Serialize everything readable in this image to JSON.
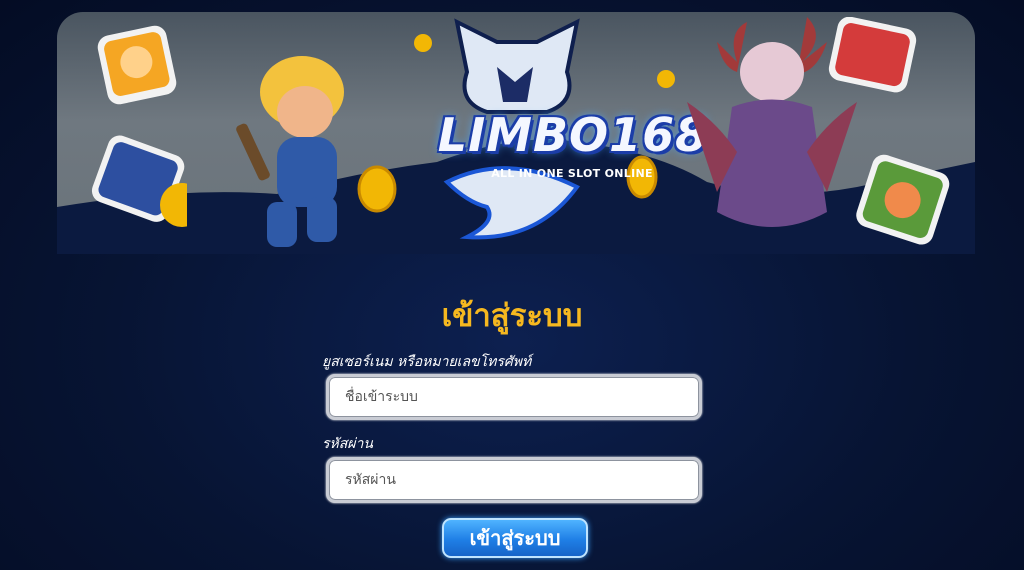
{
  "banner": {
    "logo_text": "LIMBO168",
    "tagline": "ALL IN ONE SLOT ONLINE"
  },
  "login": {
    "title": "เข้าสู่ระบบ",
    "username_label": "ยูสเซอร์เนม หรือหมายเลขโทรศัพท์",
    "username_placeholder": "ชื่อเข้าระบบ",
    "password_label": "รหัสผ่าน",
    "password_placeholder": "รหัสผ่าน",
    "submit_label": "เข้าสู่ระบบ"
  },
  "colors": {
    "title": "#f6b81f",
    "button": "#1f7fe6",
    "background": "#071433"
  }
}
